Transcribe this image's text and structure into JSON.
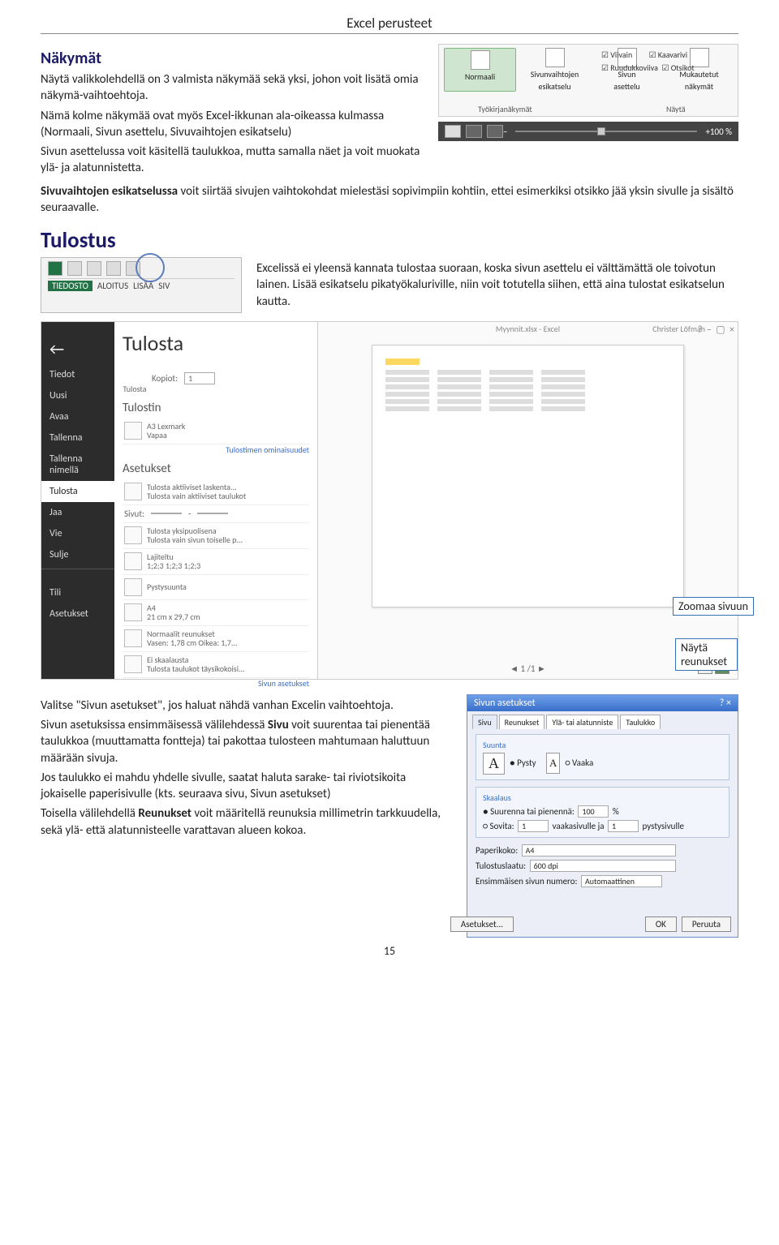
{
  "header": "Excel perusteet",
  "sec1": {
    "title": "Näkymät",
    "p1": "Näytä valikkolehdellä on 3 valmista näkymää sekä yksi, johon voit lisätä omia näkymä-vaihtoehtoja.",
    "p2a": "Nämä kolme näkymää ovat myös Excel-ikkunan ala-oikeassa kulmassa (Normaali, Sivun asettelu, Sivuvaihtojen esikatselu)",
    "p3": "Sivun asettelussa voit käsitellä taulukkoa, mutta samalla näet ja voit muokata ylä- ja alatunnistetta.",
    "p4a": "Sivuvaihtojen esikatselussa",
    "p4b": " voit siirtää sivujen vaihtokohdat mielestäsi sopivimpiin kohtiin, ettei esimerkiksi otsikko jää yksin sivulle ja sisältö seuraavalle."
  },
  "ribbon": {
    "btn1": "Normaali",
    "btn2a": "Sivunvaihtojen",
    "btn2b": "esikatselu",
    "btn3a": "Sivun",
    "btn3b": "asettelu",
    "btn4a": "Mukautetut",
    "btn4b": "näkymät",
    "group1": "Työkirjanäkymät",
    "group2": "Näytä",
    "chk1": "Viivain",
    "chk2": "Ruudukkoviiva",
    "chk3": "Kaavarivi",
    "chk4": "Otsikot"
  },
  "status": {
    "pct": "100 %",
    "minus": "−",
    "plus": "+"
  },
  "sec2": {
    "title": "Tulostus",
    "p1": "Excelissä ei yleensä kannata tulostaa suoraan, koska sivun asettelu ei välttämättä ole toivotun lainen. Lisää esikatselu pikatyökaluriville, niin voit totutella siihen, että aina tulostat esikatselun kautta."
  },
  "qat": {
    "t1": "TIEDOSTO",
    "t2": "ALOITUS",
    "t3": "LISÄÄ",
    "t4": "SIV"
  },
  "print": {
    "titlebar": "Myynnit.xlsx - Excel",
    "user": "Christer Löfman",
    "back": "←",
    "side": [
      "Tiedot",
      "Uusi",
      "Avaa",
      "Tallenna",
      "Tallenna nimellä",
      "Tulosta",
      "Jaa",
      "Vie",
      "Sulje",
      "",
      "Tili",
      "Asetukset"
    ],
    "h1": "Tulosta",
    "copies": "Kopiot:",
    "copies_n": "1",
    "btn": "Tulosta",
    "printerh": "Tulostin",
    "printer": "A3 Lexmark",
    "printerstat": "Vapaa",
    "printerlink": "Tulostimen ominaisuudet",
    "settingsh": "Asetukset",
    "s1a": "Tulosta aktiiviset laskenta...",
    "s1b": "Tulosta vain aktiiviset taulukot",
    "s2": "Sivut:",
    "s3a": "Tulosta yksipuolisena",
    "s3b": "Tulosta vain sivun toiselle p...",
    "s4a": "Lajiteltu",
    "s4b": "1;2;3   1;2;3   1;2;3",
    "s5": "Pystysuunta",
    "s6a": "A4",
    "s6b": "21 cm x 29,7 cm",
    "s7a": "Normaalit reunukset",
    "s7b": "Vasen: 1,78 cm   Oikea: 1,7...",
    "s8a": "Ei skaalausta",
    "s8b": "Tulosta taulukot täysikokoisi...",
    "s9": "Sivun asetukset",
    "page": "1",
    "pages": "/1"
  },
  "callout": {
    "zoom": "Zoomaa sivuun",
    "margins": "Näytä reunukset"
  },
  "sec3": {
    "p1": "Valitse \"Sivun asetukset\", jos haluat nähdä vanhan Excelin vaihtoehtoja.",
    "p2a": "Sivun asetuksissa ensimmäisessä välilehdessä ",
    "p2b": "Sivu",
    "p2c": " voit suurentaa tai pienentää taulukkoa (muuttamatta fontteja) tai pakottaa tulosteen mahtumaan haluttuun määrään sivuja.",
    "p3": "Jos taulukko ei mahdu yhdelle sivulle, saatat haluta sarake- tai riviotsikoita jokaiselle paperisivulle (kts. seuraava sivu, Sivun asetukset)",
    "p4a": "Toisella välilehdellä ",
    "p4b": "Reunukset",
    "p4c": " voit määritellä reunuksia millimetrin tarkkuudella, sekä ylä- että alatunnisteelle varattavan alueen kokoa."
  },
  "dlg": {
    "title": "Sivun asetukset",
    "tabs": [
      "Sivu",
      "Reunukset",
      "Ylä- tai alatunniste",
      "Taulukko"
    ],
    "g1": "Suunta",
    "dir1": "Pysty",
    "dir2": "Vaaka",
    "g2": "Skaalaus",
    "sc1": "Suurenna tai pienennä:",
    "sc1v": "100",
    "sc1u": "%",
    "sc2": "Sovita:",
    "sc2a": "1",
    "sc2b": "vaakasivulle ja",
    "sc2c": "1",
    "sc2d": "pystysivulle",
    "paper": "Paperikoko:",
    "paperv": "A4",
    "qual": "Tulostuslaatu:",
    "qualv": "600 dpi",
    "first": "Ensimmäisen sivun numero:",
    "firstv": "Automaattinen",
    "btnA": "Asetukset...",
    "btnOk": "OK",
    "btnC": "Peruuta"
  },
  "pgnum": "15"
}
